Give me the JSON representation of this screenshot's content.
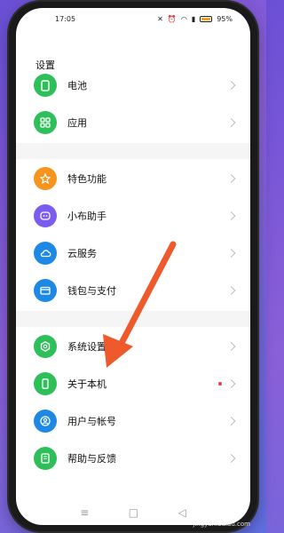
{
  "status_bar": {
    "time": "17:05",
    "battery": "95%"
  },
  "page": {
    "title": "设置"
  },
  "items": [
    {
      "label": "电池",
      "color": "#2fbf5a",
      "icon": "battery-icon"
    },
    {
      "label": "应用",
      "color": "#2fbf5a",
      "icon": "apps-grid-icon"
    },
    {
      "label": "特色功能",
      "color": "#f7941d",
      "icon": "star-badge-icon"
    },
    {
      "label": "小布助手",
      "color": "#7b5cf0",
      "icon": "assistant-icon"
    },
    {
      "label": "云服务",
      "color": "#1e88e5",
      "icon": "cloud-icon"
    },
    {
      "label": "钱包与支付",
      "color": "#1e88e5",
      "icon": "wallet-icon"
    },
    {
      "label": "系统设置",
      "color": "#2fbf5a",
      "icon": "system-settings-icon"
    },
    {
      "label": "关于本机",
      "color": "#2fbf5a",
      "icon": "phone-info-icon"
    },
    {
      "label": "用户与帐号",
      "color": "#1e88e5",
      "icon": "user-icon"
    },
    {
      "label": "帮助与反馈",
      "color": "#2fbf5a",
      "icon": "help-feedback-icon"
    }
  ],
  "navigation": {
    "menu": "≡",
    "home": "□",
    "back": "◁"
  },
  "watermark": "jingyan.baidu.com",
  "annotation": {
    "arrow_color": "#ef5a2c"
  }
}
